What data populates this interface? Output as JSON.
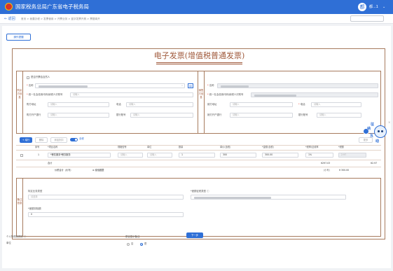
{
  "header": {
    "title": "国家税务总局广东省电子税务局",
    "user_name": "都...1",
    "user_initial": "都",
    "caret": "⌄"
  },
  "breadcrumb": {
    "back": "← 返回",
    "path": "首页 > 我要办税 > 发票使用 > 开票业务 > 蓝字发票开具 > 票据填开"
  },
  "page": {
    "tip_button": "操作提醒"
  },
  "form": {
    "title": "电子发票(增值税普通发票)",
    "buyer": {
      "section": "购买方信息",
      "natural_person": "是否开票给自然人",
      "name_label": "名称",
      "tax_label": "统一社会信用代码/纳税人识别号",
      "tax_ph": "请输入",
      "addr_label": "购方地址",
      "addr_ph": "请输入",
      "phone_label": "电话",
      "phone_ph": "请输入",
      "bank_label": "购方开户银行",
      "bank_ph": "请输入",
      "account_label": "银行账号",
      "account_ph": "请输入"
    },
    "seller": {
      "section": "销售方信息",
      "name_label": "名称",
      "tax_label": "统一社会信用代码/纳税人识别号",
      "addr_label": "销方地址",
      "addr_ph": "请输入",
      "phone_label": "电话",
      "phone_ph": "请输入",
      "bank_label": "销方开户银行",
      "bank_ph": "请输入",
      "account_label": "银行账号",
      "account_ph": "请输入"
    },
    "toolbar": {
      "add_row": "+ 增行",
      "delete": "删除",
      "discount": "添加折扣",
      "toggle_label": "含税",
      "right_btn": "更多"
    },
    "table": {
      "headers": [
        "序号",
        "*项目名称",
        "规格型号",
        "单位",
        "数量",
        "单价(含税)",
        "*金额(含税)",
        "*税率/征收率",
        "*税额"
      ],
      "row": {
        "no": "1",
        "item": "*餐饮服务*餐饮服务",
        "spec": "请输入",
        "unit": "请输入",
        "qty": "1",
        "price": "300",
        "amount": "300.00",
        "rate": "1%",
        "tax": "2.97"
      },
      "subtotal_label": "合计",
      "subtotal_amount": "¥297.03",
      "subtotal_tax": "¥2.97",
      "total_label": "价税合计（大写）",
      "total_words": "叁佰圆整",
      "total_small_label": "(小写)",
      "total_small": "¥ 300.00"
    },
    "remarks": {
      "section": "备注信息",
      "special_label": "特定业务类型",
      "special_ph": "请选择",
      "reason_label": "*差额征税类型",
      "reason_ph": "请选择",
      "extra_label": "*差额扣除额",
      "extra_value": "0"
    }
  },
  "footer": {
    "personal_label": "个人所得税预扣",
    "personal_info": "ⓘ",
    "unit_label": "单位",
    "options_label": "是否显示备注",
    "radio_no": "否",
    "radio_yes": "是"
  },
  "next_button": "下一步",
  "assistant": {
    "chars": [
      "征",
      "纳",
      "互",
      "动"
    ],
    "close": "×"
  },
  "icons": {
    "search": "⌕",
    "lookup": "▤",
    "info": "ⓘ"
  },
  "colors": {
    "brand": "#2f6fd6",
    "form_border": "#a77b5e",
    "title": "#a05a3c"
  }
}
